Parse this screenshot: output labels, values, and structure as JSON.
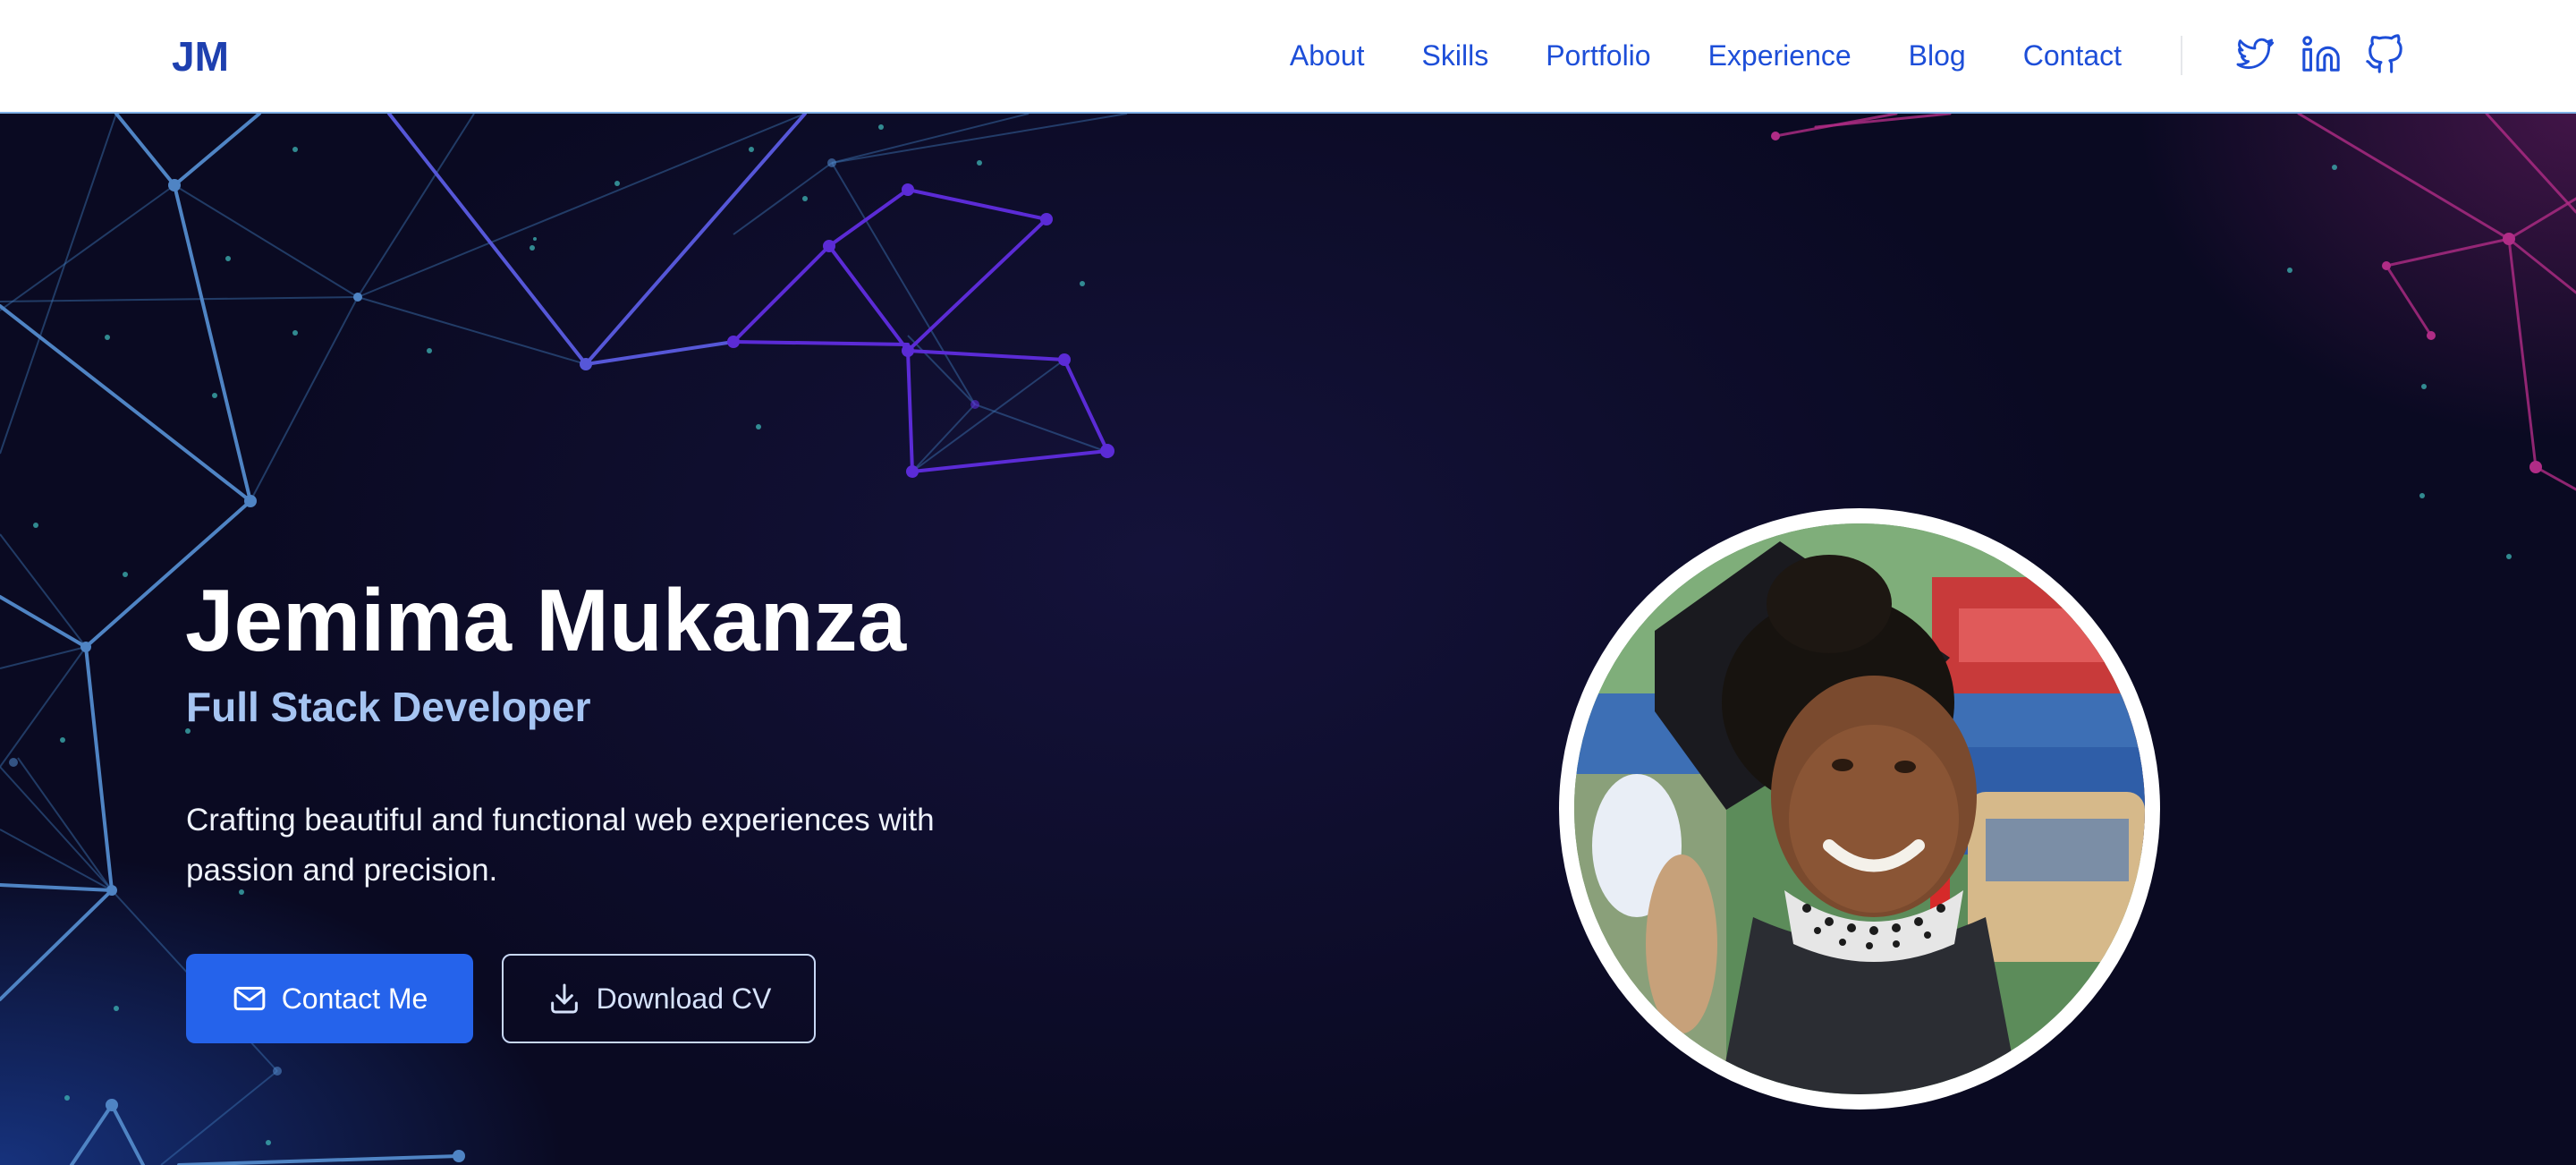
{
  "nav": {
    "logo": "JM",
    "links": [
      {
        "label": "About"
      },
      {
        "label": "Skills"
      },
      {
        "label": "Portfolio"
      },
      {
        "label": "Experience"
      },
      {
        "label": "Blog"
      },
      {
        "label": "Contact"
      }
    ],
    "social": [
      {
        "icon": "twitter-icon"
      },
      {
        "icon": "linkedin-icon"
      },
      {
        "icon": "github-icon"
      }
    ]
  },
  "hero": {
    "name": "Jemima Mukanza",
    "role": "Full Stack Developer",
    "tagline": "Crafting beautiful and functional web experiences with passion and precision.",
    "primary_button": {
      "label": "Contact Me",
      "icon": "mail-icon"
    },
    "secondary_button": {
      "label": "Download CV",
      "icon": "download-icon"
    }
  },
  "colors": {
    "brand": "#1d4ed8",
    "primary_button": "#2563eb",
    "role_text": "#a5c4f2",
    "hero_background": "#0b0b24",
    "network_blue": "#4f84c4",
    "network_purple": "#5b2bd6",
    "network_pink": "#b02c86"
  }
}
